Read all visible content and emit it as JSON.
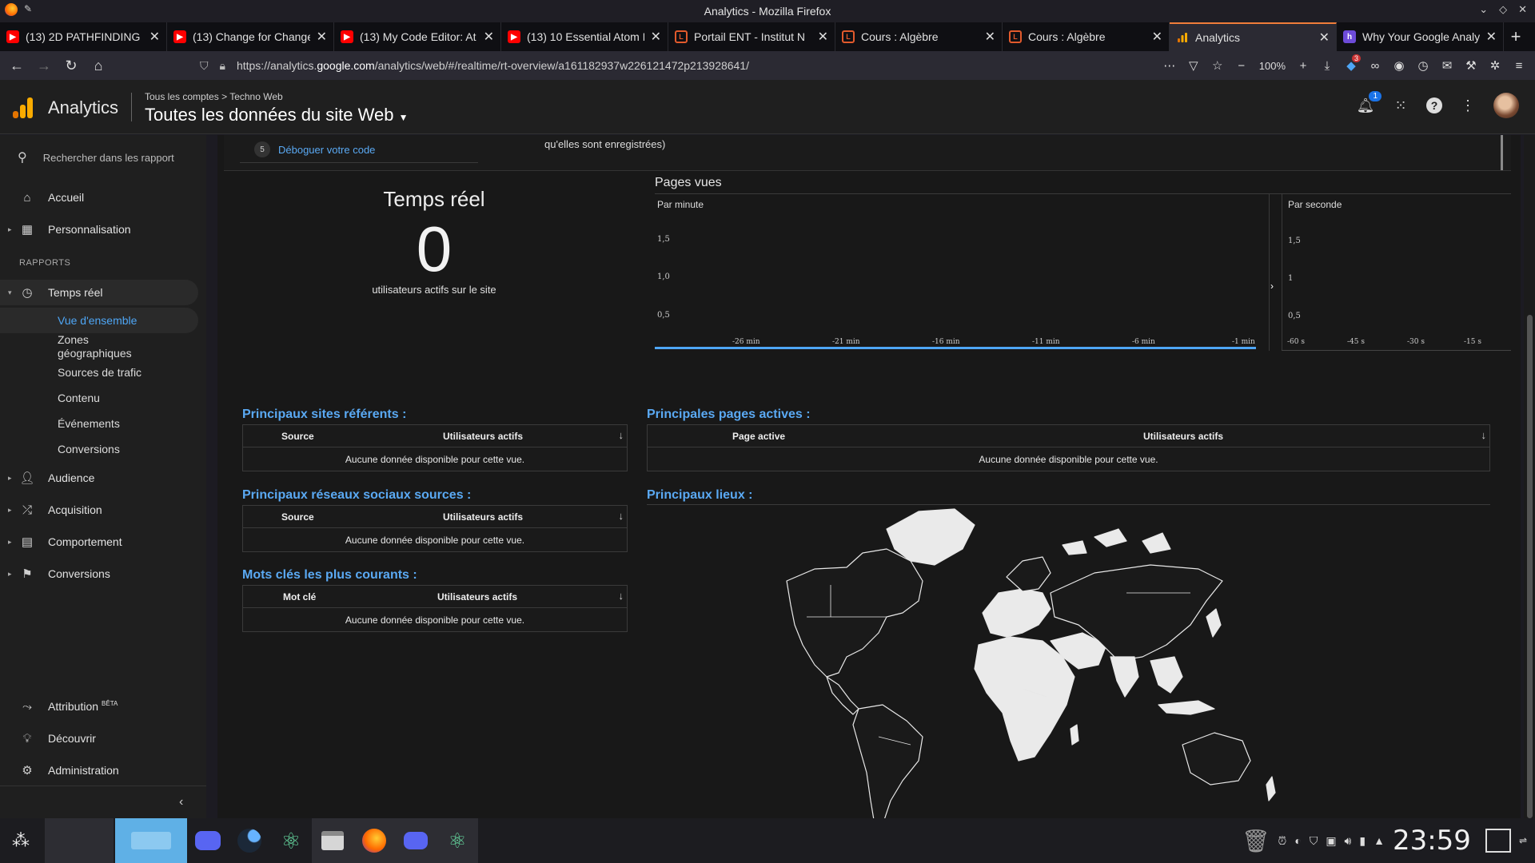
{
  "window": {
    "title": "Analytics - Mozilla Firefox"
  },
  "tabs": [
    {
      "title": "(13) 2D PATHFINDING -",
      "icon": "youtube-icon"
    },
    {
      "title": "(13) Change for Change",
      "icon": "youtube-icon"
    },
    {
      "title": "(13) My Code Editor: At",
      "icon": "youtube-icon"
    },
    {
      "title": "(13) 10 Essential Atom P",
      "icon": "youtube-icon"
    },
    {
      "title": "Portail ENT - Institut N",
      "icon": "uc-icon"
    },
    {
      "title": "Cours : Algèbre",
      "icon": "uc-icon"
    },
    {
      "title": "Cours : Algèbre",
      "icon": "uc-icon"
    },
    {
      "title": "Analytics",
      "icon": "analytics-icon"
    },
    {
      "title": "Why Your Google Analy",
      "icon": "h-icon"
    }
  ],
  "navbar": {
    "url_prefix": "https://analytics.",
    "url_domain": "google.com",
    "url_rest": "/analytics/web/#/realtime/rt-overview/a161182937w226121472p213928641/",
    "zoom": "100%",
    "extension_badge": "3"
  },
  "ga_header": {
    "product": "Analytics",
    "breadcrumb_root": "Tous les comptes",
    "breadcrumb_sep": ">",
    "breadcrumb_property": "Techno Web",
    "view": "Toutes les données du site Web",
    "notifications": "1"
  },
  "sidebar": {
    "search_placeholder": "Rechercher dans les rapport",
    "home": "Accueil",
    "customization": "Personnalisation",
    "reports_heading": "RAPPORTS",
    "realtime": "Temps réel",
    "realtime_sub": [
      "Vue d'ensemble",
      "Zones géographiques",
      "Sources de trafic",
      "Contenu",
      "Événements",
      "Conversions"
    ],
    "audience": "Audience",
    "acquisition": "Acquisition",
    "behavior": "Comportement",
    "conversions": "Conversions",
    "attribution": "Attribution",
    "attribution_badge": "BÊTA",
    "discover": "Découvrir",
    "admin": "Administration"
  },
  "main": {
    "debug_step": "5",
    "debug_link": "Déboguer votre code",
    "top_tail": "qu'elles sont enregistrées)",
    "realtime_title": "Temps réel",
    "active_users": "0",
    "active_users_label": "utilisateurs actifs sur le site",
    "pageviews_title": "Pages vues",
    "per_minute": "Par minute",
    "per_second": "Par seconde",
    "minute_yticks": [
      "1,5",
      "1,0",
      "0,5"
    ],
    "minute_xticks": [
      "-26 min",
      "-21 min",
      "-16 min",
      "-11 min",
      "-6 min",
      "-1 min"
    ],
    "second_yticks": [
      "1,5",
      "1",
      "0,5"
    ],
    "second_xticks": [
      "-60 s",
      "-45 s",
      "-30 s",
      "-15 s"
    ],
    "referrers_title": "Principaux sites référents :",
    "social_title": "Principaux réseaux sociaux sources :",
    "keywords_title": "Mots clés les plus courants :",
    "pages_title": "Principales pages actives :",
    "places_title": "Principaux lieux :",
    "col_source": "Source",
    "col_users": "Utilisateurs actifs",
    "col_keyword": "Mot clé",
    "col_page": "Page active",
    "no_data": "Aucune donnée disponible pour cette vue.",
    "sort_icon": "↓"
  },
  "taskbar": {
    "clock": "23:59"
  },
  "colors": {
    "accent_blue": "#4ea6f5",
    "ga_orange": "#f9ab00",
    "tab_accent": "#f07d3a"
  }
}
